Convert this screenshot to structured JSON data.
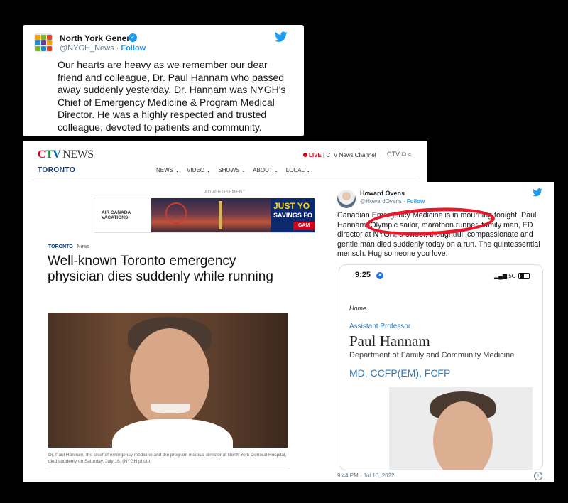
{
  "tweet1": {
    "account_name": "North York General",
    "handle": "@NYGH_News",
    "separator": " · ",
    "follow": "Follow",
    "body": "Our hearts are heavy as we remember our dear friend and colleague, Dr. Paul Hannam who passed away suddenly yesterday. Dr. Hannam was NYGH's Chief of Emergency Medicine & Program Medical Director. He was a highly respected and trusted colleague, devoted to patients and community.",
    "icons": [
      "verified-badge-icon",
      "twitter-bird-icon"
    ],
    "colors": {
      "accent": "#1d9bf0"
    }
  },
  "ctv": {
    "logo": {
      "c": "C",
      "t": "T",
      "v": "V",
      "news": "NEWS"
    },
    "city": "TORONTO",
    "live": "LIVE",
    "channel": "| CTV News Channel",
    "icons_text": "CTV",
    "nav": [
      "NEWS ⌄",
      "VIDEO ⌄",
      "SHOWS ⌄",
      "ABOUT ⌄",
      "LOCAL ⌄"
    ],
    "ad_label": "ADVERTISEMENT",
    "ad": {
      "brand_line1": "AIR CANADA",
      "brand_line2": "VACATIONS",
      "promo_line1": "JUST YO",
      "promo_line2": "SAVINGS FO",
      "promo_button": "GAM"
    },
    "breadcrumb": {
      "section": "TORONTO",
      "sub": "News"
    },
    "headline": "Well-known Toronto emergency physician dies suddenly while running",
    "caption": "Dr. Paul Hannam, the chief of emergency medicine and the program medical director at North York General Hospital, died suddenly on Saturday, July 16. (NYGH photo)",
    "colors": {
      "brand_red": "#d0021b",
      "brand_blue": "#0a3d7a"
    }
  },
  "tweet2": {
    "account_name": "Howard Ovens",
    "handle": "@HowardOvens",
    "separator": " · ",
    "follow": "Follow",
    "body": "Canadian Emergency Medicine is in mourning tonight. Paul Hannam, Olympic sailor, marathon runner, family man, ED director at NYGH, a sweet, thoughtful, compassionate and gentle man died suddenly today on a run. The quintessential mensch. Hug someone you love.",
    "timestamp": "9:44 PM · Jul 16, 2022",
    "info_icon": "i",
    "highlight_color": "#e8192c",
    "phone": {
      "time": "9:25",
      "signal": "5G",
      "home": "Home",
      "role": "Assistant Professor",
      "name": "Paul Hannam",
      "department": "Department of Family and Community Medicine",
      "credentials": "MD, CCFP(EM), FCFP"
    }
  }
}
